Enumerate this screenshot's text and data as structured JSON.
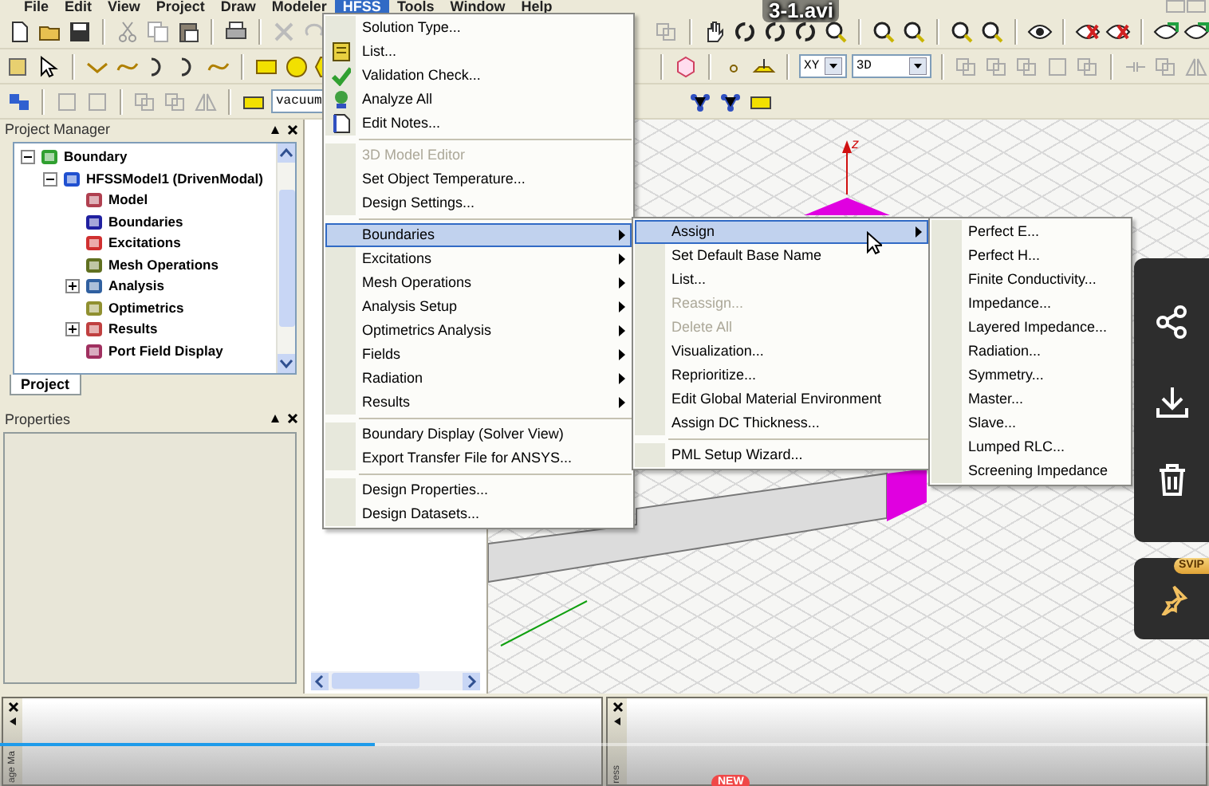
{
  "video": {
    "title": "3-1.avi",
    "progress": {
      "level": 0.31
    },
    "badge": "SVIP",
    "new_badge": "NEW"
  },
  "menu_bar": [
    {
      "label": "File",
      "selected": false
    },
    {
      "label": "Edit",
      "selected": false
    },
    {
      "label": "View",
      "selected": false
    },
    {
      "label": "Project",
      "selected": false
    },
    {
      "label": "Draw",
      "selected": false
    },
    {
      "label": "Modeler",
      "selected": false
    },
    {
      "label": "HFSS",
      "selected": true
    },
    {
      "label": "Tools",
      "selected": false
    },
    {
      "label": "Window",
      "selected": false
    },
    {
      "label": "Help",
      "selected": false
    }
  ],
  "toolbar": {
    "material": "vacuum",
    "plane": "XY",
    "view": "3D"
  },
  "project_manager": {
    "title": "Project Manager",
    "tab": "Project",
    "tree": [
      {
        "label": "Boundary",
        "expanded": true,
        "children": [
          {
            "label": "HFSSModel1 (DrivenModal)",
            "expanded": true,
            "children": [
              {
                "label": "Model"
              },
              {
                "label": "Boundaries"
              },
              {
                "label": "Excitations"
              },
              {
                "label": "Mesh Operations"
              },
              {
                "label": "Analysis",
                "expanded": false
              },
              {
                "label": "Optimetrics"
              },
              {
                "label": "Results",
                "expanded": false
              },
              {
                "label": "Port Field Display"
              }
            ]
          }
        ]
      }
    ]
  },
  "properties": {
    "title": "Properties"
  },
  "viewport": {
    "axis_label": "z"
  },
  "hfss_menu": {
    "sections": [
      {
        "items": [
          {
            "label": "Solution Type...",
            "selected": false,
            "disabled": false,
            "has_submenu": false
          },
          {
            "label": "List...",
            "selected": false,
            "disabled": false,
            "has_submenu": false
          },
          {
            "label": "Validation Check...",
            "selected": false,
            "disabled": false,
            "has_submenu": false
          },
          {
            "label": "Analyze All",
            "selected": false,
            "disabled": false,
            "has_submenu": false
          },
          {
            "label": "Edit Notes...",
            "selected": false,
            "disabled": false,
            "has_submenu": false
          }
        ]
      },
      {
        "items": [
          {
            "label": "3D Model Editor",
            "selected": false,
            "disabled": true,
            "has_submenu": false
          },
          {
            "label": "Set Object Temperature...",
            "selected": false,
            "disabled": false,
            "has_submenu": false
          },
          {
            "label": "Design Settings...",
            "selected": false,
            "disabled": false,
            "has_submenu": false
          }
        ]
      },
      {
        "items": [
          {
            "label": "Boundaries",
            "selected": true,
            "disabled": false,
            "has_submenu": true
          },
          {
            "label": "Excitations",
            "selected": false,
            "disabled": false,
            "has_submenu": true
          },
          {
            "label": "Mesh Operations",
            "selected": false,
            "disabled": false,
            "has_submenu": true
          },
          {
            "label": "Analysis Setup",
            "selected": false,
            "disabled": false,
            "has_submenu": true
          },
          {
            "label": "Optimetrics Analysis",
            "selected": false,
            "disabled": false,
            "has_submenu": true
          },
          {
            "label": "Fields",
            "selected": false,
            "disabled": false,
            "has_submenu": true
          },
          {
            "label": "Radiation",
            "selected": false,
            "disabled": false,
            "has_submenu": true
          },
          {
            "label": "Results",
            "selected": false,
            "disabled": false,
            "has_submenu": true
          }
        ]
      },
      {
        "items": [
          {
            "label": "Boundary Display (Solver View)",
            "selected": false,
            "disabled": false,
            "has_submenu": false
          },
          {
            "label": "Export Transfer File for ANSYS...",
            "selected": false,
            "disabled": false,
            "has_submenu": false
          }
        ]
      },
      {
        "items": [
          {
            "label": "Design Properties...",
            "selected": false,
            "disabled": false,
            "has_submenu": false
          },
          {
            "label": "Design Datasets...",
            "selected": false,
            "disabled": false,
            "has_submenu": false
          }
        ]
      }
    ]
  },
  "boundaries_menu": {
    "sections": [
      {
        "items": [
          {
            "label": "Assign",
            "selected": true,
            "disabled": false,
            "has_submenu": true
          },
          {
            "label": "Set Default Base Name",
            "selected": false,
            "disabled": false,
            "has_submenu": false
          },
          {
            "label": "List...",
            "selected": false,
            "disabled": false,
            "has_submenu": false
          },
          {
            "label": "Reassign...",
            "selected": false,
            "disabled": true,
            "has_submenu": false
          },
          {
            "label": "Delete All",
            "selected": false,
            "disabled": true,
            "has_submenu": false
          },
          {
            "label": "Visualization...",
            "selected": false,
            "disabled": false,
            "has_submenu": false
          },
          {
            "label": "Reprioritize...",
            "selected": false,
            "disabled": false,
            "has_submenu": false
          },
          {
            "label": "Edit Global Material Environment",
            "selected": false,
            "disabled": false,
            "has_submenu": false
          },
          {
            "label": "Assign DC Thickness...",
            "selected": false,
            "disabled": false,
            "has_submenu": false
          }
        ]
      },
      {
        "items": [
          {
            "label": "PML Setup Wizard...",
            "selected": false,
            "disabled": false,
            "has_submenu": false
          }
        ]
      }
    ]
  },
  "assign_menu": {
    "sections": [
      {
        "items": [
          {
            "label": "Perfect E...",
            "selected": false,
            "disabled": false,
            "has_submenu": false
          },
          {
            "label": "Perfect H...",
            "selected": false,
            "disabled": false,
            "has_submenu": false
          },
          {
            "label": "Finite Conductivity...",
            "selected": false,
            "disabled": false,
            "has_submenu": false
          },
          {
            "label": "Impedance...",
            "selected": false,
            "disabled": false,
            "has_submenu": false
          },
          {
            "label": "Layered Impedance...",
            "selected": false,
            "disabled": false,
            "has_submenu": false
          },
          {
            "label": "Radiation...",
            "selected": false,
            "disabled": false,
            "has_submenu": false
          },
          {
            "label": "Symmetry...",
            "selected": false,
            "disabled": false,
            "has_submenu": false
          },
          {
            "label": "Master...",
            "selected": false,
            "disabled": false,
            "has_submenu": false
          },
          {
            "label": "Slave...",
            "selected": false,
            "disabled": false,
            "has_submenu": false
          },
          {
            "label": "Lumped RLC...",
            "selected": false,
            "disabled": false,
            "has_submenu": false
          },
          {
            "label": "Screening Impedance",
            "selected": false,
            "disabled": false,
            "has_submenu": false
          }
        ]
      }
    ]
  },
  "bottom_panels": [
    {
      "label": "age Ma"
    },
    {
      "label": "ress"
    }
  ]
}
